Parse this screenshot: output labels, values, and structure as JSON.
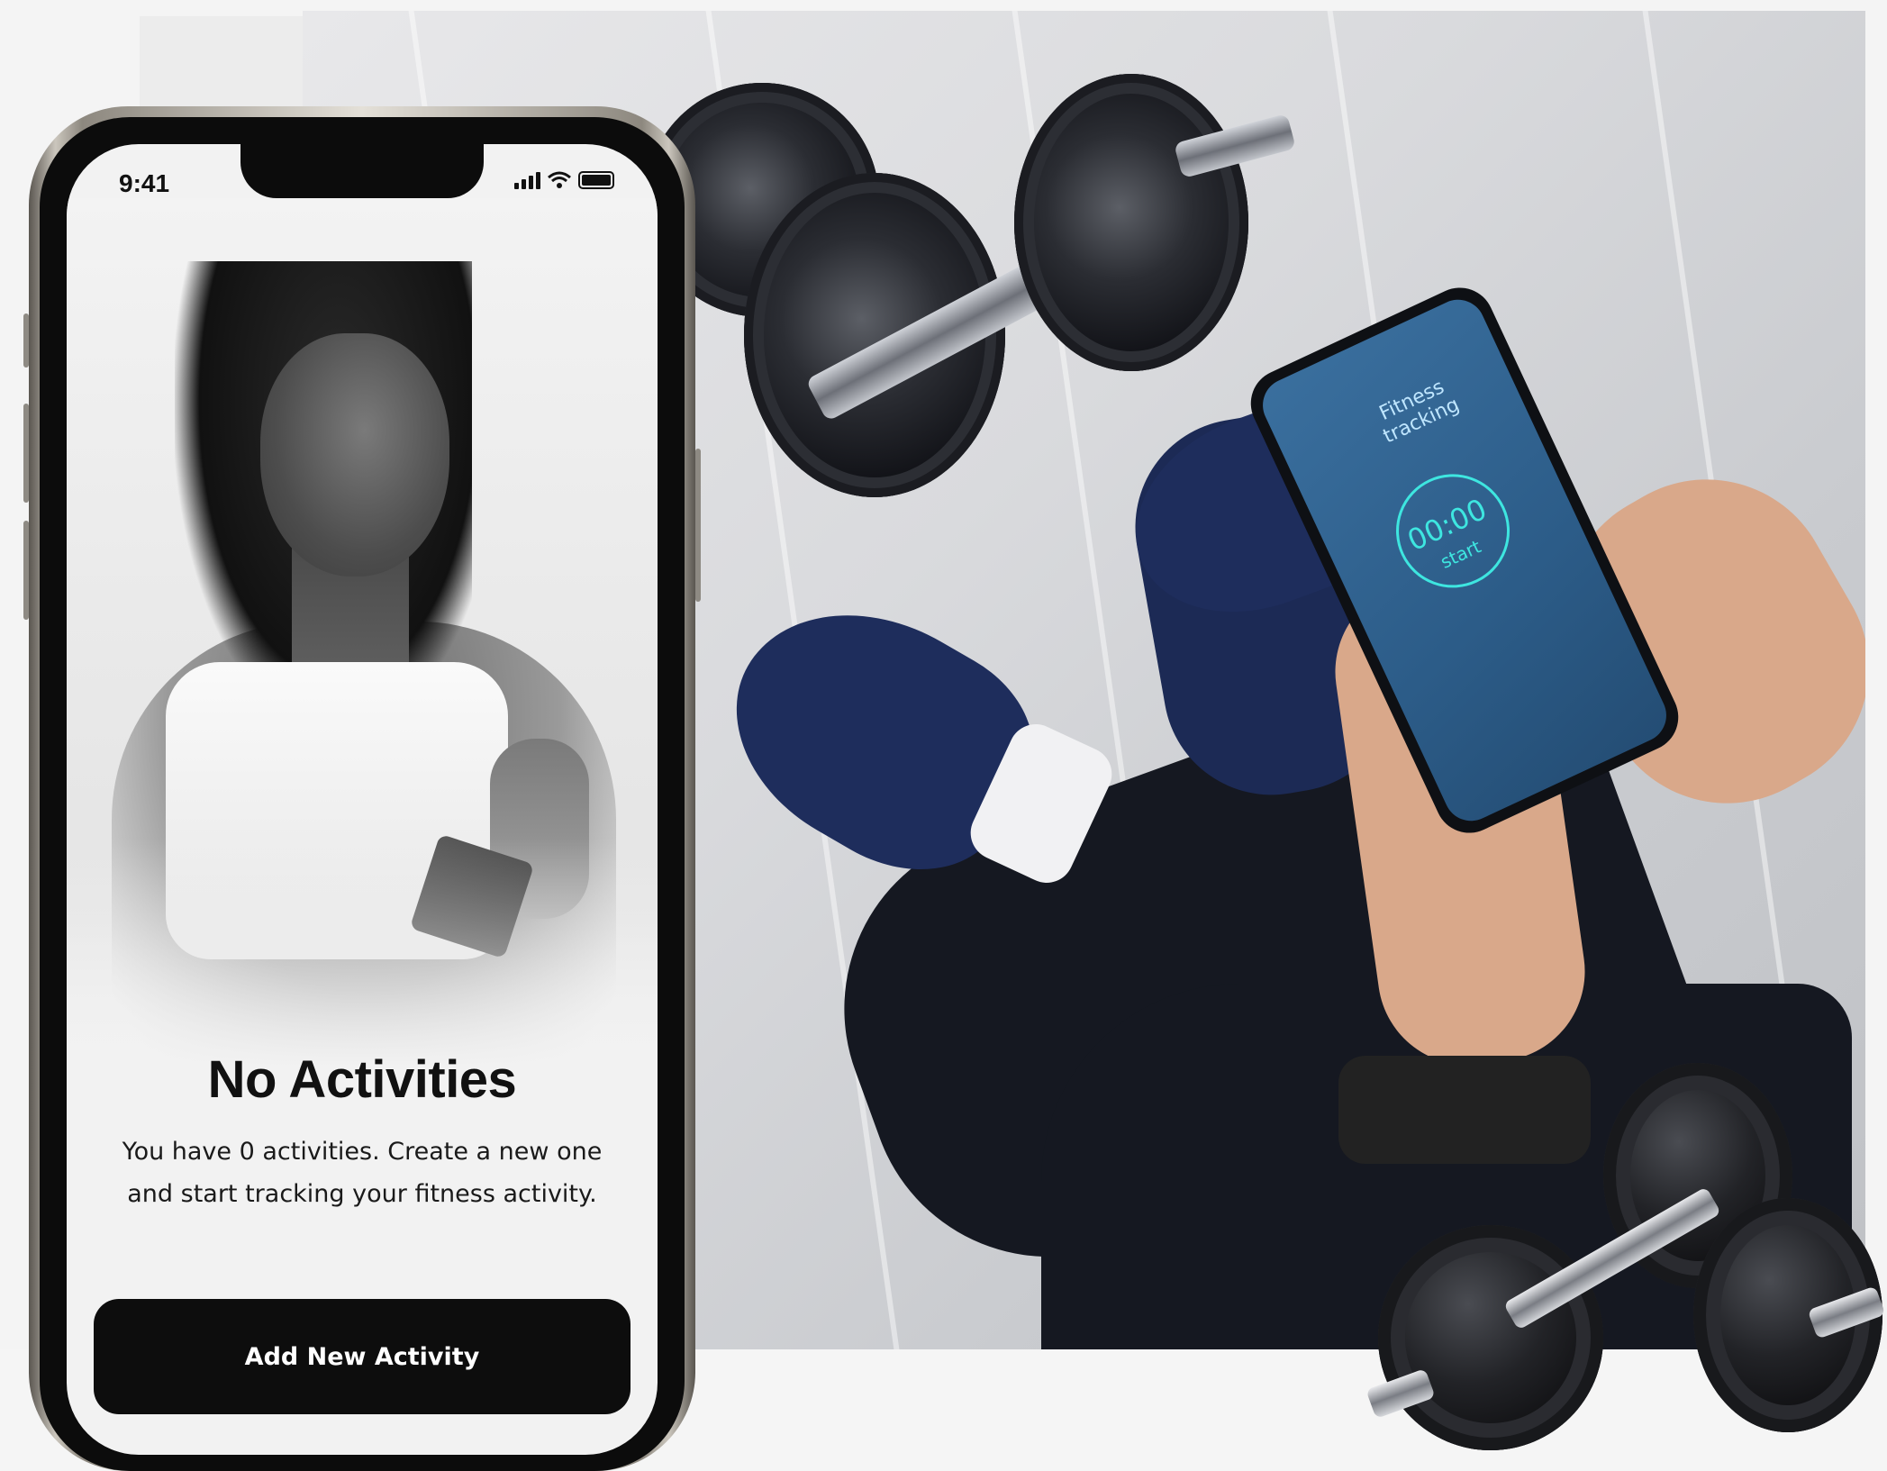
{
  "status_bar": {
    "time": "9:41",
    "icons": [
      "cellular-signal-icon",
      "wifi-icon",
      "battery-icon"
    ]
  },
  "empty_state": {
    "title": "No Activities",
    "message": "You have 0 activities. Create a new one and start tracking your fitness activity.",
    "button_label": "Add New Activity"
  },
  "held_phone": {
    "heading": "Fitness tracking",
    "timer": "00:00",
    "start_label": "start"
  },
  "colors": {
    "button_bg": "#0d0d0d",
    "button_text": "#ffffff",
    "screen_bg": "#f2f2f2",
    "accent_timer": "#3ee6e0"
  }
}
